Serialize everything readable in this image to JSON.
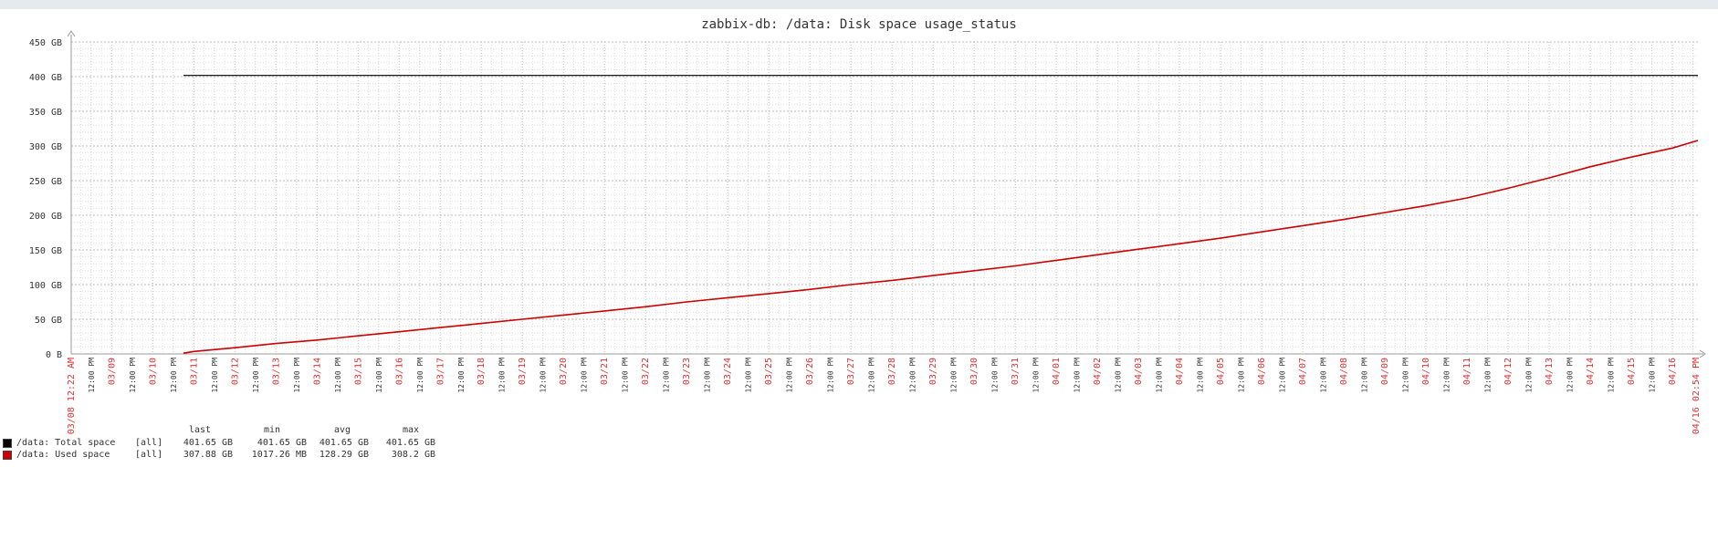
{
  "title": "zabbix-db: /data: Disk space usage_status",
  "colors": {
    "total": "#000000",
    "used": "#cc0000",
    "time_label_red": "#dd3333",
    "grid": "#c8c8c8"
  },
  "chart_data": {
    "type": "line",
    "title": "zabbix-db: /data: Disk space usage_status",
    "ylim": [
      0,
      450
    ],
    "y_unit": "GB",
    "y_ticks": [
      "0 B",
      "50 GB",
      "100 GB",
      "150 GB",
      "200 GB",
      "250 GB",
      "300 GB",
      "350 GB",
      "400 GB",
      "450 GB"
    ],
    "x_start_label": "03/08 12:22 AM",
    "x_end_label": "04/16 02:54 PM",
    "day_labels": [
      "03/09",
      "03/10",
      "03/11",
      "03/12",
      "03/13",
      "03/14",
      "03/15",
      "03/16",
      "03/17",
      "03/18",
      "03/19",
      "03/20",
      "03/21",
      "03/22",
      "03/23",
      "03/24",
      "03/25",
      "03/26",
      "03/27",
      "03/28",
      "03/29",
      "03/30",
      "03/31",
      "04/01",
      "04/02",
      "04/03",
      "04/04",
      "04/05",
      "04/06",
      "04/07",
      "04/08",
      "04/09",
      "04/10",
      "04/11",
      "04/12",
      "04/13",
      "04/14",
      "04/15",
      "04/16"
    ],
    "noon_label": "12:00 PM",
    "grid": true,
    "series": [
      {
        "name": "/data: Total space",
        "color": "#000000",
        "points": [
          [
            "03/10 06:00 PM",
            401.65
          ],
          [
            "04/16 02:54 PM",
            401.65
          ]
        ]
      },
      {
        "name": "/data: Used space",
        "color": "#cc0000",
        "points": [
          [
            "03/10 06:00 PM",
            1.0
          ],
          [
            "03/11 12:00 AM",
            3.5
          ],
          [
            "03/12 12:00 AM",
            9
          ],
          [
            "03/13 12:00 AM",
            15
          ],
          [
            "03/14 12:00 AM",
            20
          ],
          [
            "03/15 12:00 AM",
            26
          ],
          [
            "03/16 12:00 AM",
            32
          ],
          [
            "03/17 12:00 AM",
            38
          ],
          [
            "03/18 12:00 AM",
            44
          ],
          [
            "03/19 12:00 AM",
            50
          ],
          [
            "03/20 12:00 AM",
            56
          ],
          [
            "03/21 12:00 AM",
            62
          ],
          [
            "03/22 12:00 AM",
            68
          ],
          [
            "03/23 12:00 AM",
            75
          ],
          [
            "03/24 12:00 AM",
            81
          ],
          [
            "03/25 12:00 AM",
            87
          ],
          [
            "03/26 12:00 AM",
            93
          ],
          [
            "03/27 12:00 AM",
            100
          ],
          [
            "03/28 12:00 AM",
            106
          ],
          [
            "03/29 12:00 AM",
            113
          ],
          [
            "03/30 12:00 AM",
            120
          ],
          [
            "03/31 12:00 AM",
            127
          ],
          [
            "04/01 12:00 AM",
            135
          ],
          [
            "04/02 12:00 AM",
            143
          ],
          [
            "04/03 12:00 AM",
            151
          ],
          [
            "04/04 12:00 AM",
            159
          ],
          [
            "04/05 12:00 AM",
            167
          ],
          [
            "04/06 12:00 AM",
            176
          ],
          [
            "04/07 12:00 AM",
            185
          ],
          [
            "04/08 12:00 AM",
            194
          ],
          [
            "04/09 12:00 AM",
            204
          ],
          [
            "04/10 12:00 AM",
            214
          ],
          [
            "04/11 12:00 AM",
            225
          ],
          [
            "04/12 12:00 AM",
            239
          ],
          [
            "04/13 12:00 AM",
            254
          ],
          [
            "04/14 12:00 AM",
            270
          ],
          [
            "04/15 12:00 AM",
            284
          ],
          [
            "04/16 12:00 AM",
            297
          ],
          [
            "04/16 02:54 PM",
            307.88
          ]
        ]
      }
    ]
  },
  "legend": {
    "headers": {
      "last": "last",
      "min": "min",
      "avg": "avg",
      "max": "max"
    },
    "rows": [
      {
        "name": "/data: Total space",
        "scope": "[all]",
        "last": "401.65 GB",
        "min": "401.65 GB",
        "avg": "401.65 GB",
        "max": "401.65 GB",
        "color": "#000000"
      },
      {
        "name": "/data: Used space",
        "scope": "[all]",
        "last": "307.88 GB",
        "min": "1017.26 MB",
        "avg": "128.29 GB",
        "max": "308.2 GB",
        "color": "#cc0000"
      }
    ]
  }
}
